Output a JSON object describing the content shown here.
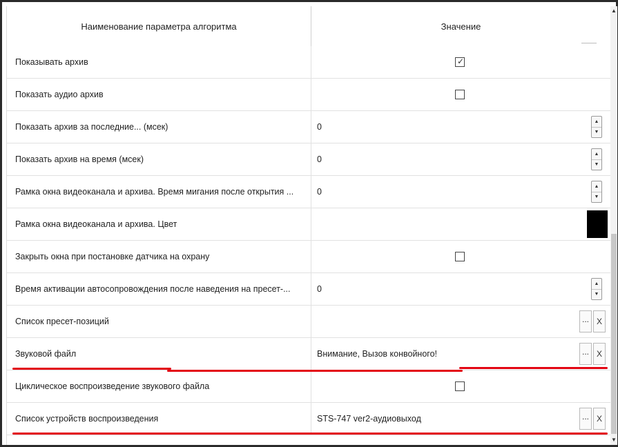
{
  "table": {
    "columns": [
      "Наименование параметра алгоритма",
      "Значение"
    ],
    "rows": [
      {
        "name": "Показывать архив",
        "type": "checkbox",
        "checked": true,
        "value": ""
      },
      {
        "name": "Показать аудио архив",
        "type": "checkbox",
        "checked": false,
        "value": ""
      },
      {
        "name": "Показать архив за последние... (мсек)",
        "type": "spin",
        "value": "0"
      },
      {
        "name": "Показать архив на время (мсек)",
        "type": "spin",
        "value": "0"
      },
      {
        "name": "Рамка окна видеоканала и архива. Время мигания после открытия ...",
        "type": "spin",
        "value": "0"
      },
      {
        "name": "Рамка окна видеоканала и архива. Цвет",
        "type": "color",
        "value": "",
        "color": "#000000"
      },
      {
        "name": "Закрыть окна при постановке датчика на охрану",
        "type": "checkbox",
        "checked": false,
        "value": ""
      },
      {
        "name": "Время активации автосопровождения после наведения на пресет-...",
        "type": "spin",
        "value": "0"
      },
      {
        "name": "Список пресет-позиций",
        "type": "browse",
        "value": ""
      },
      {
        "name": "Звуковой файл",
        "type": "browse",
        "value": "Внимание, Вызов конвойного!"
      },
      {
        "name": "Циклическое воспроизведение звукового файла",
        "type": "checkbox",
        "checked": false,
        "value": ""
      },
      {
        "name": "Список устройств воспроизведения",
        "type": "browse",
        "value": "STS-747 ver2-аудиовыход"
      }
    ]
  },
  "buttons": {
    "browse_label": "...",
    "clear_label": "X"
  },
  "icons": {
    "check": "✓",
    "spin_up": "▲",
    "spin_down": "▼",
    "scroll_up": "▲",
    "scroll_down": "▼"
  },
  "accent": {
    "highlight_underline": "#e30613",
    "swatch": "#000000"
  }
}
